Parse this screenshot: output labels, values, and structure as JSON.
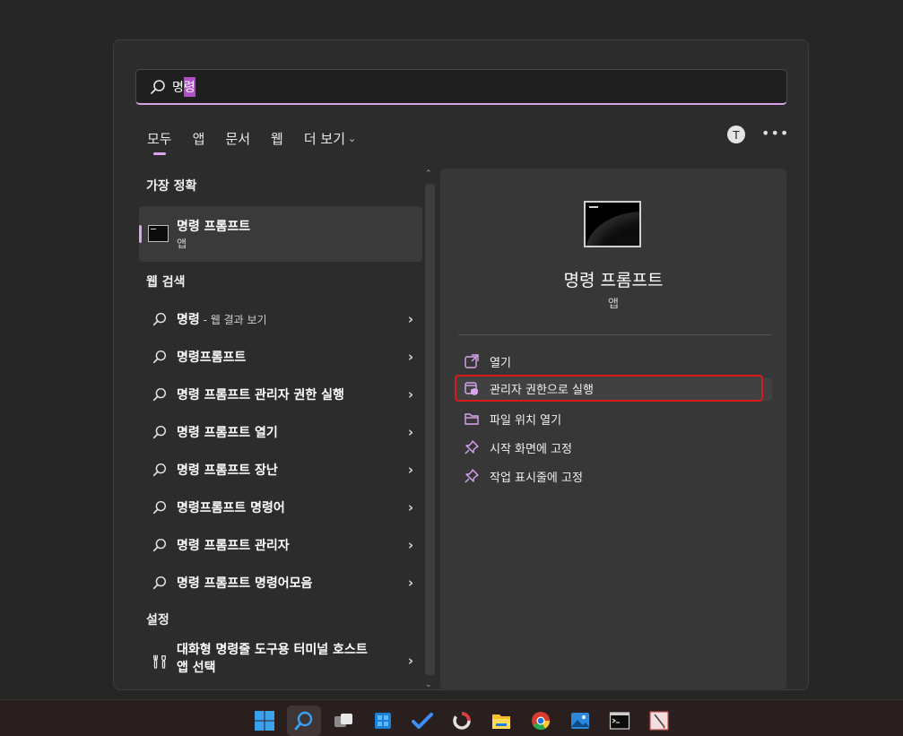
{
  "search": {
    "typed": "명",
    "selected": "령"
  },
  "tabs": [
    {
      "label": "모두",
      "active": true
    },
    {
      "label": "앱"
    },
    {
      "label": "문서"
    },
    {
      "label": "웹"
    },
    {
      "label": "더 보기",
      "dropdown": true
    }
  ],
  "header": {
    "avatar_initial": "T",
    "more_label": "•••"
  },
  "best_match": {
    "section_title": "가장 정확",
    "title": "명령 프롬프트",
    "subtitle": "앱"
  },
  "web_search": {
    "section_title": "웹 검색",
    "items": [
      {
        "label": "명령",
        "suffix": " - 웹 결과 보기"
      },
      {
        "label": "명령프롬프트"
      },
      {
        "label": "명령 프롬프트 관리자 권한 실행"
      },
      {
        "label": "명령 프롬프트 열기"
      },
      {
        "label": "명령 프롬프트 장난"
      },
      {
        "label": "명령프롬프트 명령어"
      },
      {
        "label": "명령 프롬프트 관리자"
      },
      {
        "label": "명령 프롬프트 명령어모음"
      }
    ]
  },
  "settings": {
    "section_title": "설정",
    "items": [
      {
        "label": "대화형 명령줄 도구용 터미널 호스트 앱 선택"
      }
    ]
  },
  "detail": {
    "title": "명령 프롬프트",
    "subtitle": "앱",
    "actions": [
      {
        "label": "열기",
        "icon": "open-external-icon"
      },
      {
        "label": "관리자 권한으로 실행",
        "icon": "shield-run-admin-icon",
        "highlighted": true
      },
      {
        "label": "파일 위치 열기",
        "icon": "folder-icon"
      },
      {
        "label": "시작 화면에 고정",
        "icon": "pin-icon"
      },
      {
        "label": "작업 표시줄에 고정",
        "icon": "pin-icon"
      }
    ]
  },
  "colors": {
    "accent": "#d9a6ee",
    "highlight_border": "#d41c1c",
    "panel_bg": "#2c2c2c",
    "detail_bg": "#373737"
  },
  "taskbar": {
    "icons": [
      "windows-start-icon",
      "search-icon",
      "task-view-icon",
      "store-icon",
      "todo-icon",
      "app-circle-icon",
      "file-explorer-icon",
      "chrome-icon",
      "photos-icon",
      "command-prompt-icon",
      "paint-icon"
    ]
  }
}
